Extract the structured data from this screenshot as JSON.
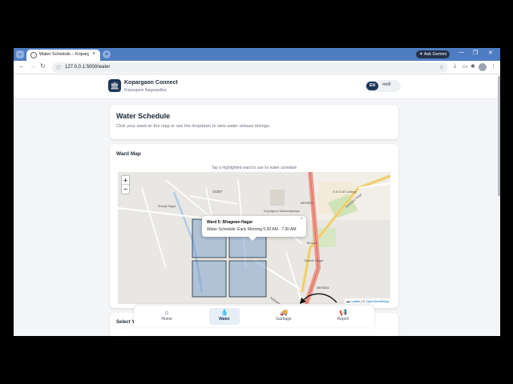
{
  "browser": {
    "tab_title": "Water Schedule – Kopargaon C",
    "tab_close": "×",
    "new_tab": "+",
    "ask_gemini": "✦ Ask Gemini",
    "url": "127.0.0.1:5000/water",
    "window_min": "—",
    "window_max": "❐",
    "window_close": "✕",
    "icons": {
      "back": "back-arrow-icon",
      "forward": "forward-arrow-icon",
      "reload": "reload-icon",
      "bookmark": "star-icon",
      "download": "download-icon",
      "extensions": "puzzle-icon",
      "menu": "kebab-menu-icon"
    }
  },
  "header": {
    "app_name": "Kopargaon Connect",
    "subtitle": "Kopargaon Nagarpalika",
    "logo_icon": "building-icon",
    "lang_en": "EN",
    "lang_mr": "मराठी",
    "brand_color": "#1d3557"
  },
  "intro": {
    "title": "Water Schedule",
    "description": "Click your ward on the map or use the dropdown to view water release timings."
  },
  "map_card": {
    "title": "Ward Map",
    "hint": "Tap a highlighted ward to use its water schedule",
    "zoom_in": "+",
    "zoom_out": "−",
    "popup": {
      "title": "Ward 5: Bhagwan Nagar",
      "schedule": "Water Schedule: Early Morning 5:30 AM - 7:30 AM",
      "close": "×"
    },
    "attribution_flag": "▬",
    "attribution_leaflet": "Leaflet",
    "attribution_sep": " | © ",
    "attribution_osm": "OpenStreetMap",
    "labels": {
      "odbt": "ODBT",
      "sjsm": "S.S.G.M College",
      "nh752g_1": "NH752G",
      "nh752g_2": "NH752G",
      "road_1": "Sanjivani Road",
      "area_1": "Kopargaon Mahavidyalaya",
      "place_1": "Bhuvan",
      "place_2": "Ganesh Nagar",
      "road_2": "Mahatma Gandhi Road",
      "place_3": "Shivaji Nagar"
    },
    "ward_color": "#6b95c6"
  },
  "select_card": {
    "label": "Select Y"
  },
  "bottom_nav": {
    "items": [
      {
        "label": "Home",
        "icon": "home-icon",
        "glyph": "⌂"
      },
      {
        "label": "Water",
        "icon": "water-drop-icon",
        "glyph": "💧"
      },
      {
        "label": "Garbage",
        "icon": "truck-icon",
        "glyph": "🚚"
      },
      {
        "label": "Report",
        "icon": "megaphone-icon",
        "glyph": "📢"
      }
    ]
  }
}
